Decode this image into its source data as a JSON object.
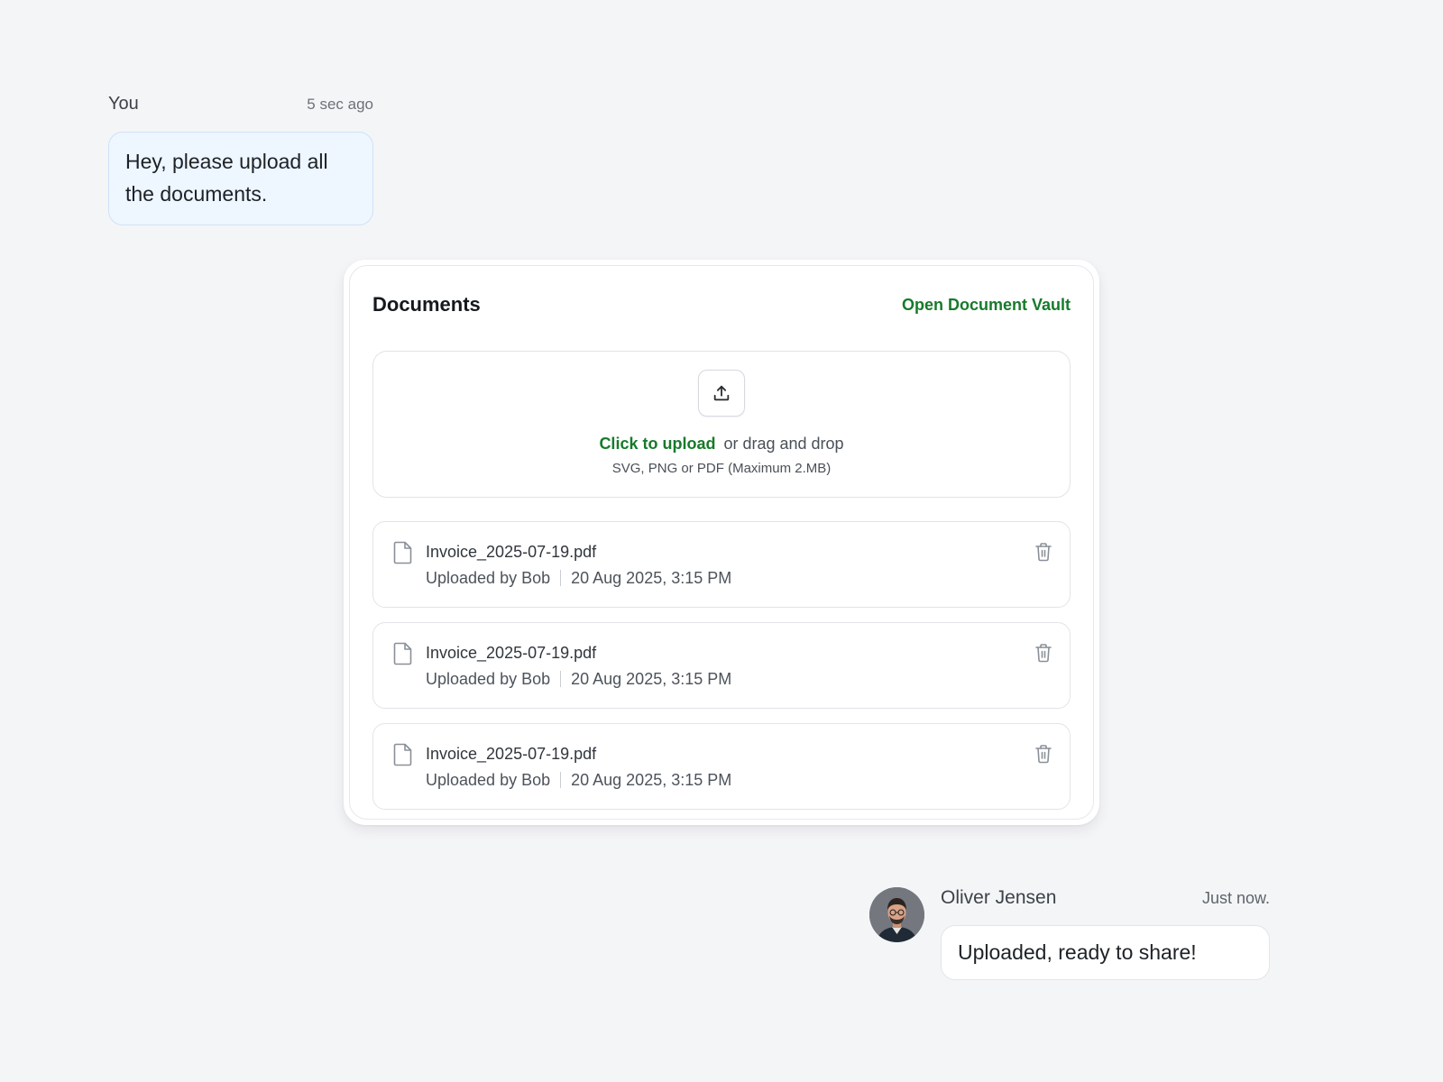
{
  "chat": {
    "outgoing": {
      "sender": "You",
      "time": "5 sec ago",
      "text": "Hey, please upload all the documents."
    },
    "incoming": {
      "sender": "Oliver Jensen",
      "time": "Just now.",
      "text": "Uploaded, ready to share!",
      "avatar": "avatar-photo"
    }
  },
  "documents": {
    "title": "Documents",
    "vault_link": "Open Document Vault",
    "upload": {
      "icon": "upload-icon",
      "click_label": "Click to upload",
      "drag_label": "or drag and drop",
      "hint": "SVG, PNG or PDF (Maximum 2.MB)"
    },
    "files": [
      {
        "name": "Invoice_2025-07-19.pdf",
        "uploader": "Uploaded by Bob",
        "date": "20 Aug 2025, 3:15 PM"
      },
      {
        "name": "Invoice_2025-07-19.pdf",
        "uploader": "Uploaded by Bob",
        "date": "20 Aug 2025, 3:15 PM"
      },
      {
        "name": "Invoice_2025-07-19.pdf",
        "uploader": "Uploaded by Bob",
        "date": "20 Aug 2025, 3:15 PM"
      }
    ]
  },
  "colors": {
    "accent_green": "#177a2b",
    "outgoing_bubble": "#eef6ff",
    "page_bg": "#f4f5f7"
  }
}
